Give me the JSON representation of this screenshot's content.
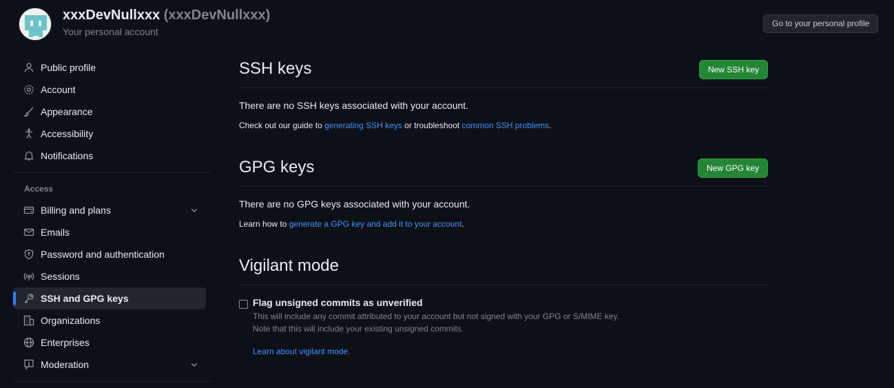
{
  "header": {
    "display_name": "xxxDevNullxxx",
    "login": "(xxxDevNullxxx)",
    "subtitle": "Your personal account",
    "profile_button": "Go to your personal profile"
  },
  "sidebar": {
    "items": [
      {
        "label": "Public profile",
        "icon": "person-icon"
      },
      {
        "label": "Account",
        "icon": "gear-icon"
      },
      {
        "label": "Appearance",
        "icon": "paintbrush-icon"
      },
      {
        "label": "Accessibility",
        "icon": "accessibility-icon"
      },
      {
        "label": "Notifications",
        "icon": "bell-icon"
      }
    ],
    "access_label": "Access",
    "access_items": [
      {
        "label": "Billing and plans",
        "icon": "credit-card-icon",
        "expandable": true
      },
      {
        "label": "Emails",
        "icon": "mail-icon"
      },
      {
        "label": "Password and authentication",
        "icon": "shield-lock-icon"
      },
      {
        "label": "Sessions",
        "icon": "broadcast-icon"
      },
      {
        "label": "SSH and GPG keys",
        "icon": "key-icon",
        "active": true
      },
      {
        "label": "Organizations",
        "icon": "organization-icon"
      },
      {
        "label": "Enterprises",
        "icon": "globe-icon"
      },
      {
        "label": "Moderation",
        "icon": "report-icon",
        "expandable": true
      }
    ]
  },
  "ssh": {
    "title": "SSH keys",
    "button": "New SSH key",
    "empty": "There are no SSH keys associated with your account.",
    "help_prefix": "Check out our guide to ",
    "help_link1": "generating SSH keys",
    "help_mid": " or troubleshoot ",
    "help_link2": "common SSH problems",
    "help_suffix": "."
  },
  "gpg": {
    "title": "GPG keys",
    "button": "New GPG key",
    "empty": "There are no GPG keys associated with your account.",
    "help_prefix": "Learn how to ",
    "help_link": "generate a GPG key and add it to your account",
    "help_suffix": "."
  },
  "vigilant": {
    "title": "Vigilant mode",
    "checkbox_label": "Flag unsigned commits as unverified",
    "checked": false,
    "note1": "This will include any commit attributed to your account but not signed with your GPG or S/MIME key.",
    "note2": "Note that this will include your existing unsigned commits.",
    "link": "Learn about vigilant mode."
  },
  "colors": {
    "background": "#0d1117",
    "accent_blue": "#2f81f7",
    "link": "#4493f8",
    "button_green": "#238636"
  }
}
